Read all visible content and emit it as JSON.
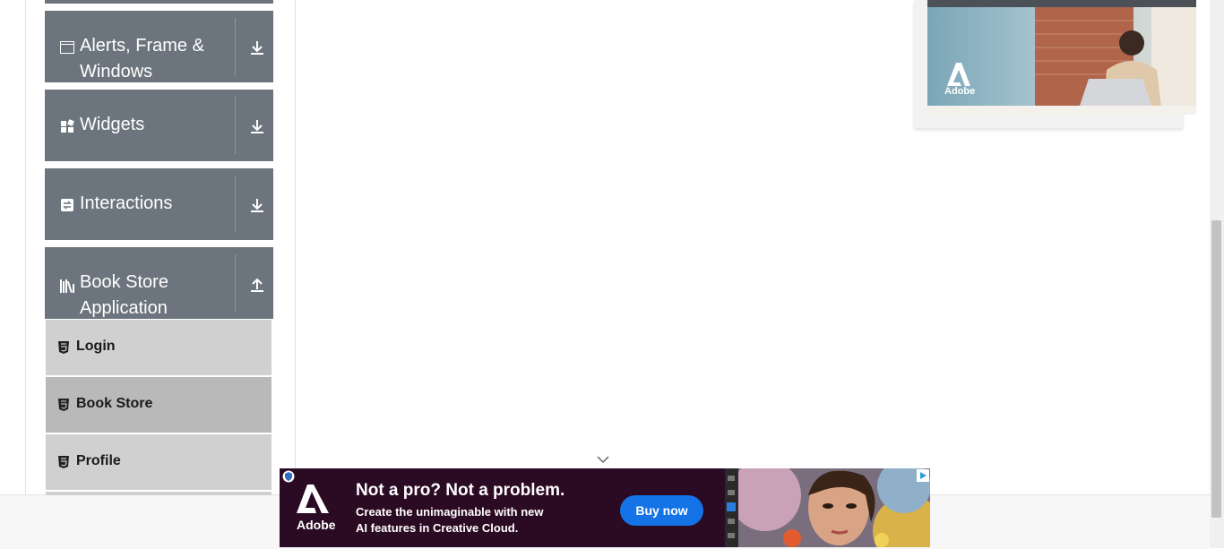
{
  "sidebar": {
    "groups": [
      {
        "label": "Alerts, Frame & Windows",
        "icon": "window-icon",
        "toggle": "expand-down-icon"
      },
      {
        "label": "Widgets",
        "icon": "widgets-icon",
        "toggle": "expand-down-icon"
      },
      {
        "label": "Interactions",
        "icon": "interactions-icon",
        "toggle": "expand-down-icon"
      },
      {
        "label": "Book Store Application",
        "icon": "books-icon",
        "toggle": "collapse-up-icon"
      }
    ],
    "book_store_items": [
      {
        "label": "Login",
        "icon": "html5-icon"
      },
      {
        "label": "Book Store",
        "icon": "html5-icon",
        "active": true
      },
      {
        "label": "Profile",
        "icon": "html5-icon"
      }
    ]
  },
  "ads": {
    "top": {
      "brand": "Adobe"
    },
    "bottom": {
      "brand": "Adobe",
      "headline": "Not a pro? Not a problem.",
      "body_line1": "Create the unimaginable with new",
      "body_line2": "AI features in Creative Cloud.",
      "cta": "Buy now"
    }
  },
  "colors": {
    "group_bg": "#6c757d",
    "sub_item_bg": "#d0d0d0",
    "sub_item_active_bg": "#b9b9b9",
    "ad_bg": "#2b0a23",
    "cta_bg": "#1473e6"
  }
}
